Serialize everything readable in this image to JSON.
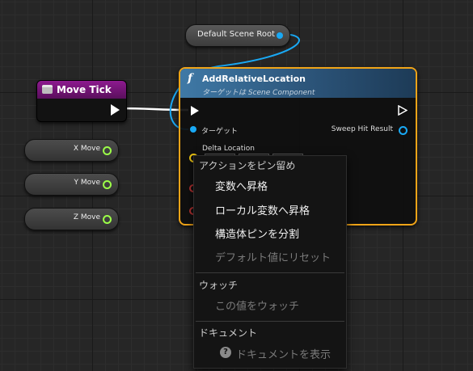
{
  "scene_root_node": {
    "label": "Default Scene Root"
  },
  "event_node": {
    "title": "Move Tick"
  },
  "float_getters": [
    {
      "label": "X Move"
    },
    {
      "label": "Y Move"
    },
    {
      "label": "Z Move"
    }
  ],
  "function_node": {
    "title": "AddRelativeLocation",
    "subtitle": "ターゲットは Scene Component",
    "target_label": "ターゲット",
    "sweep_label": "Sweep Hit Result",
    "delta_label": "Delta Location"
  },
  "context_menu": {
    "pin_actions_header": "アクションをピン留め",
    "promote_variable": "変数へ昇格",
    "promote_local_variable": "ローカル変数へ昇格",
    "split_struct_pin": "構造体ピンを分割",
    "reset_default": "デフォルト値にリセット",
    "watch_header": "ウォッチ",
    "watch_value": "この値をウォッチ",
    "docs_header": "ドキュメント",
    "view_docs": "ドキュメントを表示",
    "help_icon_glyph": "?"
  },
  "colors": {
    "exec_wire": "#ffffff",
    "object_pin": "#19a9f5",
    "float_pin": "#9cff48",
    "vector_pin": "#f0c814",
    "selection_outline": "#f0a418",
    "event_header": "#8d1a8f",
    "function_header": "#3f79a6"
  }
}
